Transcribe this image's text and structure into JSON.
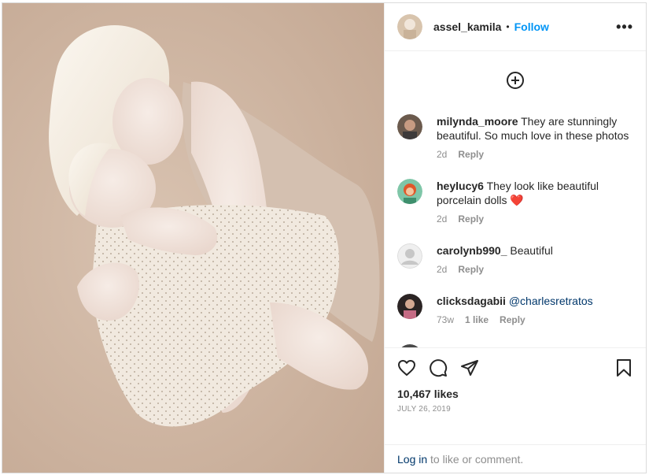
{
  "header": {
    "username": "assel_kamila",
    "separator": "•",
    "follow_label": "Follow",
    "more_label": "•••"
  },
  "comments": [
    {
      "user": "milynda_moore",
      "text": "They are stunningly beautiful. So much love in these photos",
      "time": "2d",
      "reply": "Reply"
    },
    {
      "user": "heylucy6",
      "text": "They look like beautiful porcelain dolls",
      "emoji": "❤️",
      "time": "2d",
      "reply": "Reply"
    },
    {
      "user": "carolynb990_",
      "text": "Beautiful",
      "time": "2d",
      "reply": "Reply"
    },
    {
      "user": "clicksdagabii",
      "mention": "@charlesretratos",
      "time": "73w",
      "likes": "1 like",
      "reply": "Reply"
    }
  ],
  "post": {
    "likes": "10,467 likes",
    "date": "JULY 26, 2019"
  },
  "footer": {
    "login_link": "Log in",
    "login_rest": " to like or comment."
  },
  "icons": {
    "load_more": "plus-circle-icon",
    "like": "heart-icon",
    "comment": "comment-icon",
    "share": "share-icon",
    "save": "bookmark-icon"
  },
  "colors": {
    "link_blue": "#0095f6",
    "dark_link": "#00376b",
    "muted": "#8e8e8e",
    "text": "#262626"
  }
}
